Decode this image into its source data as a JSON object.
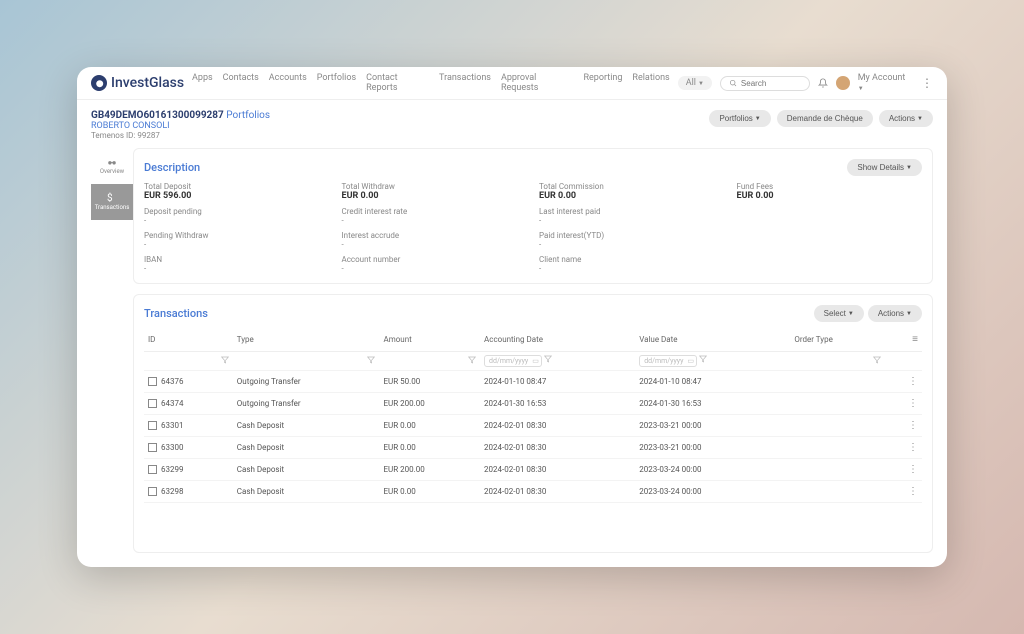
{
  "brand": "InvestGlass",
  "nav": [
    "Apps",
    "Contacts",
    "Accounts",
    "Portfolios",
    "Contact Reports",
    "Transactions",
    "Approval Requests",
    "Reporting",
    "Relations"
  ],
  "all_label": "All",
  "search_placeholder": "Search",
  "my_account": "My Account",
  "breadcrumb": {
    "pid": "GB49DEMO60161300099287",
    "plink": "Portfolios",
    "owner": "ROBERTO CONSOLI",
    "tid": "Temenos ID: 99287"
  },
  "header_buttons": {
    "portfolios": "Portfolios",
    "cheque": "Demande de Chèque",
    "actions": "Actions"
  },
  "sidebar": {
    "overview": "Overview",
    "transactions": "Transactions"
  },
  "description": {
    "title": "Description",
    "show_details": "Show Details",
    "total_deposit_label": "Total Deposit",
    "total_deposit_value": "EUR 596.00",
    "deposit_pending_label": "Deposit pending",
    "deposit_pending_value": "-",
    "pending_withdraw_label": "Pending Withdraw",
    "pending_withdraw_value": "-",
    "iban_label": "IBAN",
    "iban_value": "-",
    "total_withdraw_label": "Total Withdraw",
    "total_withdraw_value": "EUR 0.00",
    "credit_rate_label": "Credit interest rate",
    "credit_rate_value": "-",
    "interest_accrude_label": "Interest accrude",
    "interest_accrude_value": "-",
    "account_number_label": "Account number",
    "account_number_value": "-",
    "total_commission_label": "Total Commission",
    "total_commission_value": "EUR 0.00",
    "last_interest_label": "Last interest paid",
    "last_interest_value": "-",
    "paid_ytd_label": "Paid interest(YTD)",
    "paid_ytd_value": "-",
    "client_name_label": "Client name",
    "client_name_value": "-",
    "fund_fees_label": "Fund Fees",
    "fund_fees_value": "EUR 0.00"
  },
  "transactions": {
    "title": "Transactions",
    "select": "Select",
    "actions": "Actions",
    "headers": {
      "id": "ID",
      "type": "Type",
      "amount": "Amount",
      "accounting_date": "Accounting Date",
      "value_date": "Value Date",
      "order_type": "Order Type"
    },
    "date_placeholder": "dd/mm/yyyy",
    "rows": [
      {
        "id": "64376",
        "type": "Outgoing Transfer",
        "amount": "EUR 50.00",
        "acct": "2024-01-10 08:47",
        "vdate": "2024-01-10 08:47"
      },
      {
        "id": "64374",
        "type": "Outgoing Transfer",
        "amount": "EUR 200.00",
        "acct": "2024-01-30 16:53",
        "vdate": "2024-01-30 16:53"
      },
      {
        "id": "63301",
        "type": "Cash Deposit",
        "amount": "EUR 0.00",
        "acct": "2024-02-01 08:30",
        "vdate": "2023-03-21 00:00"
      },
      {
        "id": "63300",
        "type": "Cash Deposit",
        "amount": "EUR 0.00",
        "acct": "2024-02-01 08:30",
        "vdate": "2023-03-21 00:00"
      },
      {
        "id": "63299",
        "type": "Cash Deposit",
        "amount": "EUR 200.00",
        "acct": "2024-02-01 08:30",
        "vdate": "2023-03-24 00:00"
      },
      {
        "id": "63298",
        "type": "Cash Deposit",
        "amount": "EUR 0.00",
        "acct": "2024-02-01 08:30",
        "vdate": "2023-03-24 00:00"
      }
    ]
  }
}
